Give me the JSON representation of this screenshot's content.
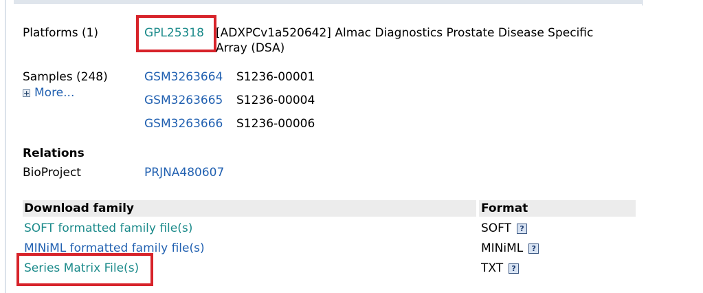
{
  "platforms": {
    "label": "Platforms (1)",
    "id": "GPL25318",
    "description_line1": "[ADXPCv1a520642] Almac Diagnostics Prostate Disease Specific",
    "description_line2": "Array (DSA)"
  },
  "samples": {
    "label": "Samples (248)",
    "more": "More...",
    "items": [
      {
        "id": "GSM3263664",
        "name": "S1236-00001"
      },
      {
        "id": "GSM3263665",
        "name": "S1236-00004"
      },
      {
        "id": "GSM3263666",
        "name": "S1236-00006"
      }
    ]
  },
  "relations": {
    "heading": "Relations",
    "bioproject_label": "BioProject",
    "bioproject_id": "PRJNA480607"
  },
  "download": {
    "header_family": "Download family",
    "header_format": "Format",
    "rows": [
      {
        "label": "SOFT formatted family file(s)",
        "format": "SOFT"
      },
      {
        "label": "MINiML formatted family file(s)",
        "format": "MINiML"
      },
      {
        "label": "Series Matrix File(s)",
        "format": "TXT"
      }
    ],
    "help_glyph": "?"
  },
  "colors": {
    "link_blue": "#2261b1",
    "visited_teal": "#1b8a8a",
    "highlight_red": "#d7232a",
    "header_gray": "#ececec"
  }
}
